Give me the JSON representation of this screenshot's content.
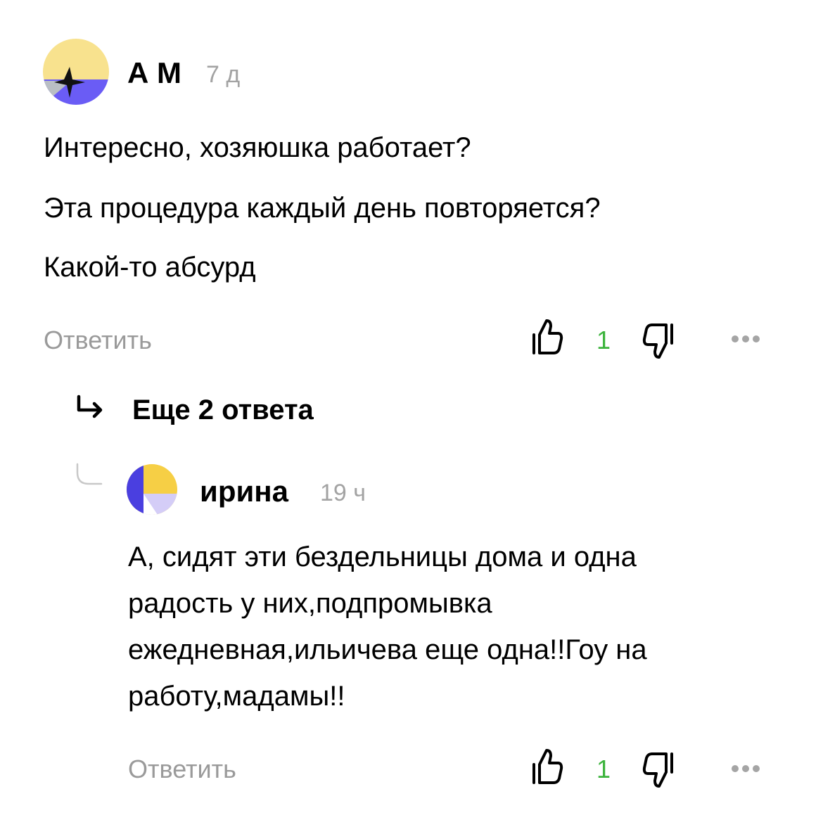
{
  "comment1": {
    "author": "А М",
    "time": "7 д",
    "lines": [
      "Интересно, хозяюшка работает?",
      "Эта процедура каждый день повторяется?",
      "Какой-то абсурд"
    ],
    "reply_label": "Ответить",
    "likes": "1"
  },
  "thread": {
    "more_replies_label": "Еще 2 ответа"
  },
  "comment2": {
    "author": "ирина",
    "time": "19 ч",
    "lines": [
      "А, сидят эти бездельницы дома и одна",
      "радость у них,подпромывка",
      "ежедневная,ильичева еще одна!!Гоу на",
      "работу,мадамы!!"
    ],
    "reply_label": "Ответить",
    "likes": "1"
  },
  "colors": {
    "like_count": "#3bb33b",
    "muted": "#9a9a9a",
    "avatar_yellow": "#f8e28e",
    "avatar_purple": "#6a5cf5"
  },
  "icons": [
    "thumbs-up-icon",
    "thumbs-down-icon",
    "more-dots-icon",
    "reply-arrow-icon",
    "thread-connector-icon"
  ]
}
